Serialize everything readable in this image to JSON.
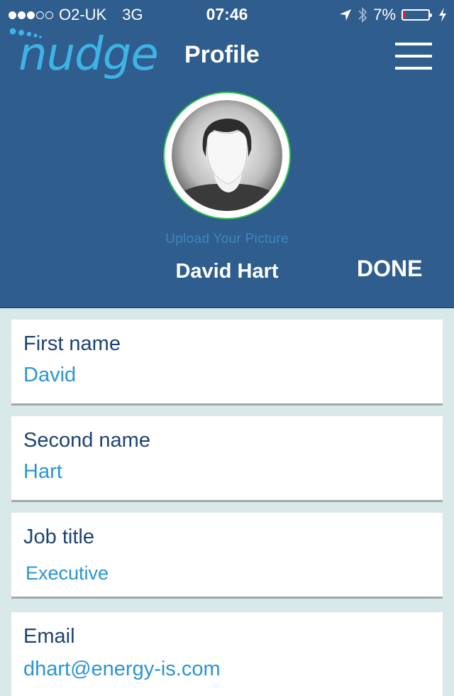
{
  "status_bar": {
    "signal_full": 3,
    "signal_empty": 2,
    "carrier": "O2-UK",
    "network": "3G",
    "time": "07:46",
    "battery_percent_label": "7%",
    "battery_level": 0.07,
    "icons": [
      "location-arrow-icon",
      "bluetooth-icon",
      "battery-icon",
      "charging-bolt-icon"
    ]
  },
  "header": {
    "logo_text": "nudge",
    "title": "Profile",
    "menu_icon": "hamburger-menu-icon"
  },
  "profile": {
    "upload_label": "Upload Your Picture",
    "full_name": "David Hart",
    "done_label": "DONE"
  },
  "colors": {
    "header_bg": "#2e5d8e",
    "page_bg": "#d9e8e8",
    "label": "#1d4371",
    "value": "#2a95d3",
    "logo": "#3db3e6",
    "avatar_ring": "#2ec24a"
  },
  "fields": [
    {
      "label": "First name",
      "value": "David"
    },
    {
      "label": "Second name",
      "value": "Hart"
    },
    {
      "label": "Job title",
      "value": "Executive"
    },
    {
      "label": "Email",
      "value": "dhart@energy-is.com"
    }
  ]
}
